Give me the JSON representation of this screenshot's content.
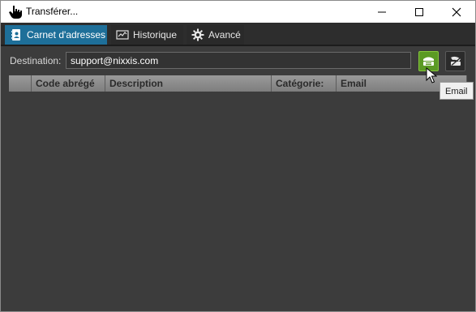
{
  "window": {
    "title": "Transférer...",
    "icon": "hand-pointer-icon",
    "controls": [
      "minimize-icon",
      "maximize-icon",
      "close-icon"
    ]
  },
  "tabs": [
    {
      "label": "Carnet d'adresses",
      "icon": "address-book-icon",
      "active": true
    },
    {
      "label": "Historique",
      "icon": "history-chart-icon",
      "active": false
    },
    {
      "label": "Avancé",
      "icon": "gear-icon",
      "active": false
    }
  ],
  "destination": {
    "label": "Destination:",
    "value": "support@nixxis.com"
  },
  "buttons": {
    "email": {
      "icon": "email-icon",
      "color": "#5b9a24"
    },
    "other": {
      "icon": "phone-icon"
    }
  },
  "grid": {
    "columns": [
      "",
      "Code abrégé",
      "Description",
      "Catégorie:",
      "Email"
    ],
    "rows": []
  },
  "tooltip": {
    "text": "Email"
  },
  "colors": {
    "background": "#3c3c3c",
    "active_tab": "#1e6f99",
    "email_button": "#5b9a24"
  }
}
